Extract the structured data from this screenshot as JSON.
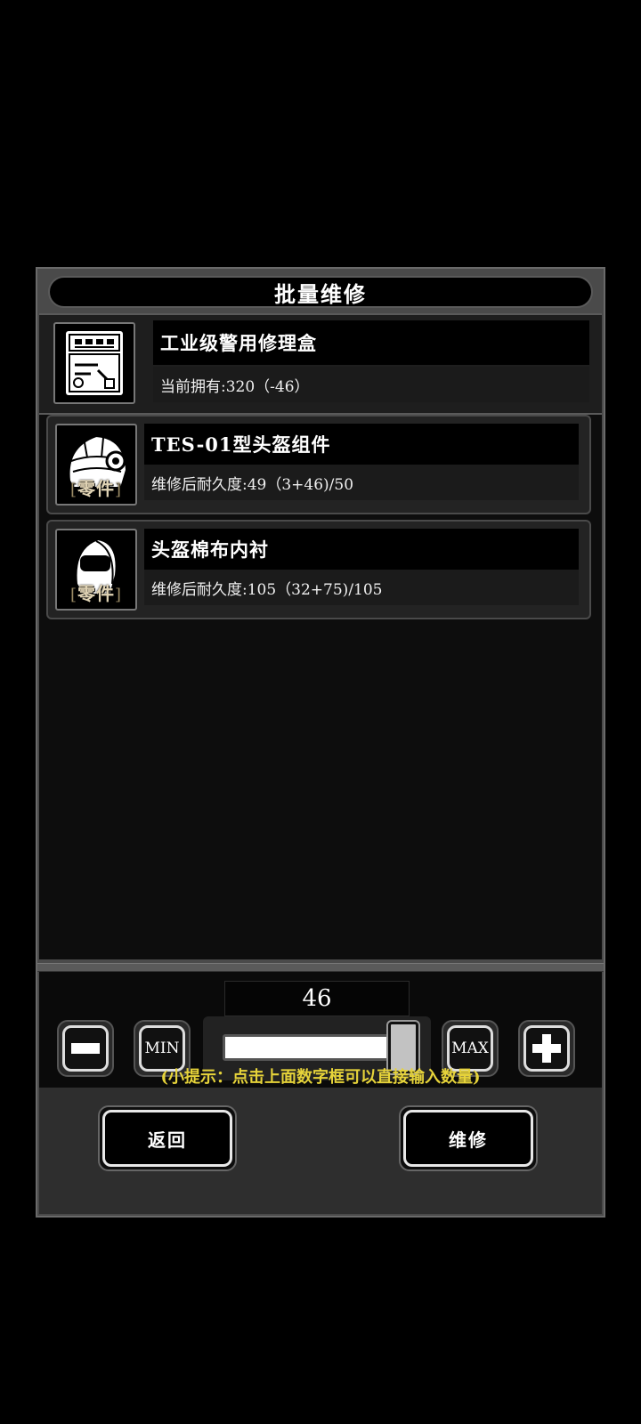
{
  "dialog": {
    "title": "批量维修",
    "repair_item": {
      "name": "工业级警用修理盒",
      "owned_text": "当前拥有:320（-46）",
      "icon": "repair-kit-icon"
    },
    "parts": [
      {
        "name": "TES-01型头盔组件",
        "durability_text": "维修后耐久度:49（3+46)/50",
        "tag": "零件",
        "icon": "helmet-component-icon"
      },
      {
        "name": "头盔棉布内衬",
        "durability_text": "维修后耐久度:105（32+75)/105",
        "tag": "零件",
        "icon": "helmet-liner-icon"
      }
    ]
  },
  "controls": {
    "quantity": "46",
    "slider_fraction": 1.0,
    "min_label": "MIN",
    "max_label": "MAX",
    "hint": "(小提示：点击上面数字框可以直接输入数量)"
  },
  "buttons": {
    "back_label": "返回",
    "repair_label": "维修"
  },
  "colors": {
    "hint": "#e6d33a",
    "tag": "#e0d3b4",
    "background": "#000000"
  }
}
